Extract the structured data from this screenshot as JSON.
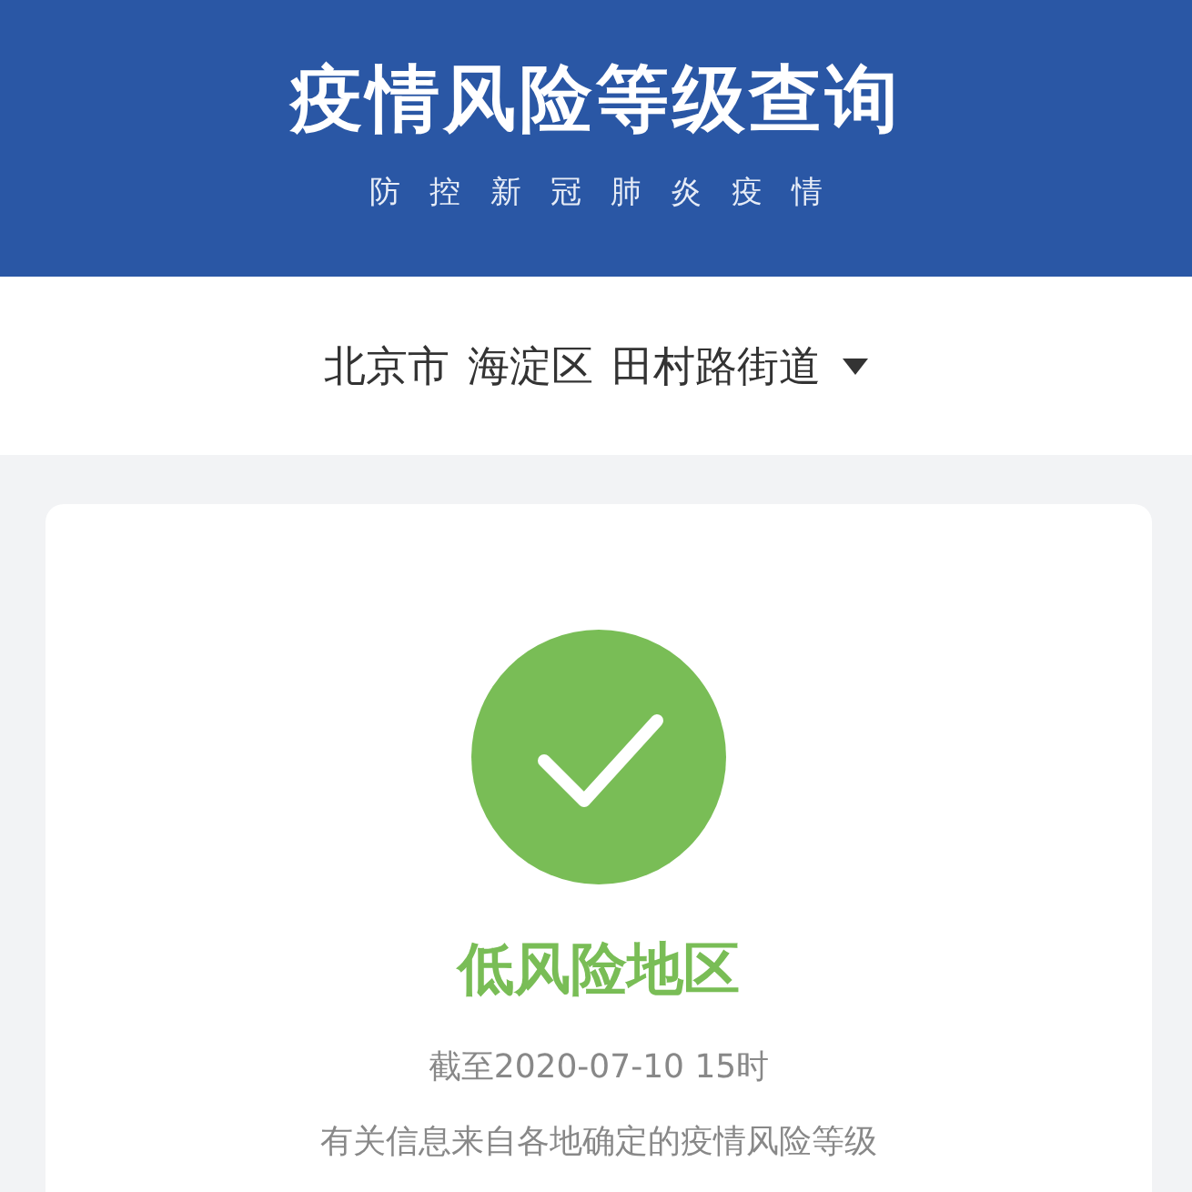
{
  "header": {
    "title": "疫情风险等级查询",
    "subtitle": "防控新冠肺炎疫情"
  },
  "location": {
    "parts": [
      "北京市",
      "海淀区",
      "田村路街道"
    ]
  },
  "result": {
    "kind": "low",
    "label": "低风险地区",
    "updated": "截至2020-07-10 15时",
    "note": "有关信息来自各地确定的疫情风险等级"
  }
}
